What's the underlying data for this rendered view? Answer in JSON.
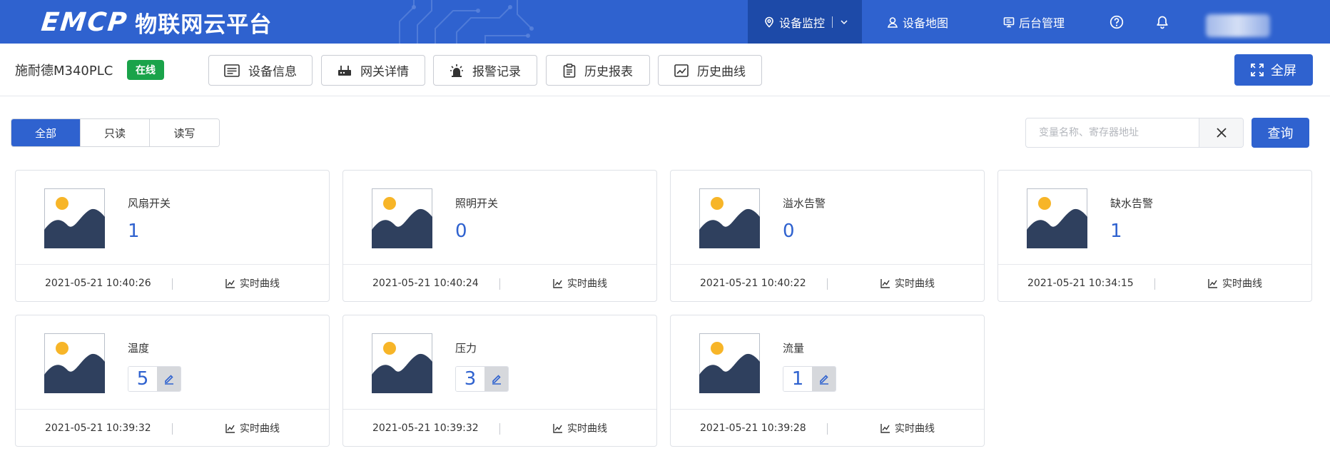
{
  "topnav": {
    "logo_text": "EMCP",
    "logo_subtitle": "物联网云平台",
    "items": [
      {
        "label": "设备监控",
        "icon": "monitor-pin-icon",
        "active": true
      },
      {
        "label": "设备地图",
        "icon": "map-pin-icon"
      },
      {
        "label": "后台管理",
        "icon": "admin-screen-icon"
      }
    ],
    "help_icon": "help-circle-icon",
    "bell_icon": "bell-icon",
    "accent_color": "#2f62cf"
  },
  "device": {
    "name": "施耐德M340PLC",
    "status": "在线",
    "status_color": "#1aa34a",
    "tabs": [
      {
        "label": "设备信息",
        "icon": "device-info-icon"
      },
      {
        "label": "网关详情",
        "icon": "gateway-icon"
      },
      {
        "label": "报警记录",
        "icon": "alarm-icon"
      },
      {
        "label": "历史报表",
        "icon": "clipboard-icon"
      },
      {
        "label": "历史曲线",
        "icon": "chart-icon"
      }
    ],
    "fullscreen_label": "全屏"
  },
  "filter": {
    "segments": [
      "全部",
      "只读",
      "读写"
    ],
    "active_segment": "全部",
    "search_placeholder": "变量名称、寄存器地址",
    "search_value": "",
    "query_label": "查询"
  },
  "cards": [
    {
      "label": "风扇开关",
      "value": "1",
      "time": "2021-05-21 10:40:26",
      "trend_label": "实时曲线",
      "writable": false
    },
    {
      "label": "照明开关",
      "value": "0",
      "time": "2021-05-21 10:40:24",
      "trend_label": "实时曲线",
      "writable": false
    },
    {
      "label": "溢水告警",
      "value": "0",
      "time": "2021-05-21 10:40:22",
      "trend_label": "实时曲线",
      "writable": false
    },
    {
      "label": "缺水告警",
      "value": "1",
      "time": "2021-05-21 10:34:15",
      "trend_label": "实时曲线",
      "writable": false
    },
    {
      "label": "温度",
      "value": "5",
      "time": "2021-05-21 10:39:32",
      "trend_label": "实时曲线",
      "writable": true
    },
    {
      "label": "压力",
      "value": "3",
      "time": "2021-05-21 10:39:32",
      "trend_label": "实时曲线",
      "writable": true
    },
    {
      "label": "流量",
      "value": "1",
      "time": "2021-05-21 10:39:28",
      "trend_label": "实时曲线",
      "writable": true
    }
  ]
}
